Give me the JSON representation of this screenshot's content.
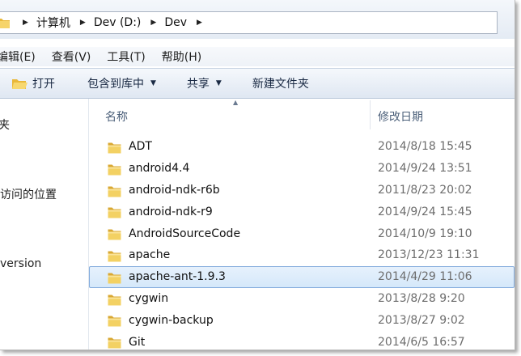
{
  "address": {
    "crumbs": [
      "计算机",
      "Dev (D:)",
      "Dev"
    ]
  },
  "menu": {
    "items": [
      "编辑(E)",
      "查看(V)",
      "工具(T)",
      "帮助(H)"
    ]
  },
  "toolbar": {
    "open": "打开",
    "include_library": "包含到库中",
    "share": "共享",
    "new_folder": "新建文件夹"
  },
  "nav": {
    "items": [
      "夹",
      "",
      "",
      "访问的位置",
      "version"
    ]
  },
  "columns": {
    "name": "名称",
    "date": "修改日期"
  },
  "files": [
    {
      "name": "ADT",
      "date": "2014/8/18 15:45"
    },
    {
      "name": "android4.4",
      "date": "2014/9/24 13:51"
    },
    {
      "name": "android-ndk-r6b",
      "date": "2011/8/23 20:02"
    },
    {
      "name": "android-ndk-r9",
      "date": "2014/9/24 15:45"
    },
    {
      "name": "AndroidSourceCode",
      "date": "2014/10/9 19:10"
    },
    {
      "name": "apache",
      "date": "2013/12/23 11:31"
    },
    {
      "name": "apache-ant-1.9.3",
      "date": "2014/4/29 11:06",
      "selected": true
    },
    {
      "name": "cygwin",
      "date": "2013/8/28 9:20"
    },
    {
      "name": "cygwin-backup",
      "date": "2013/8/27 9:02"
    },
    {
      "name": "Git",
      "date": "2014/6/5 16:57"
    }
  ],
  "colors": {
    "selection_bg": "#d9eafb",
    "selection_border": "#84acdd",
    "header_text": "#4c607a",
    "folder_yellow": "#f2cf5b"
  }
}
